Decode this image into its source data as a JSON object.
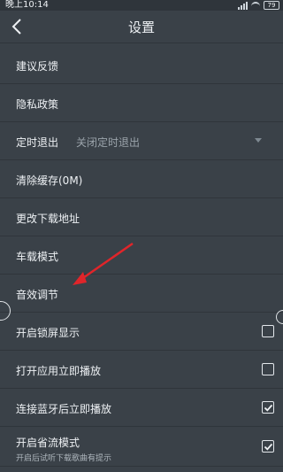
{
  "status_bar": {
    "time": "晚上10:14",
    "battery": "79"
  },
  "header": {
    "title": "设置"
  },
  "settings": {
    "feedback": "建议反馈",
    "privacy": "隐私政策",
    "timer_exit": "定时退出",
    "timer_exit_value": "关闭定时退出",
    "clear_cache": "清除缓存(0M)",
    "download_path": "更改下载地址",
    "car_mode": "车载模式",
    "sound_effects": "音效调节",
    "lockscreen_display": "开启锁屏显示",
    "play_on_open": "打开应用立即播放",
    "play_on_bluetooth": "连接蓝牙后立即播放",
    "data_saver": "开启省流模式",
    "data_saver_hint": "开启后试听下载歌曲有提示"
  },
  "toggles": {
    "lockscreen_display": false,
    "play_on_open": false,
    "play_on_bluetooth": true,
    "data_saver": true
  },
  "annotation": {
    "arrow_color": "#e0252a",
    "points_to": "音效调节"
  }
}
